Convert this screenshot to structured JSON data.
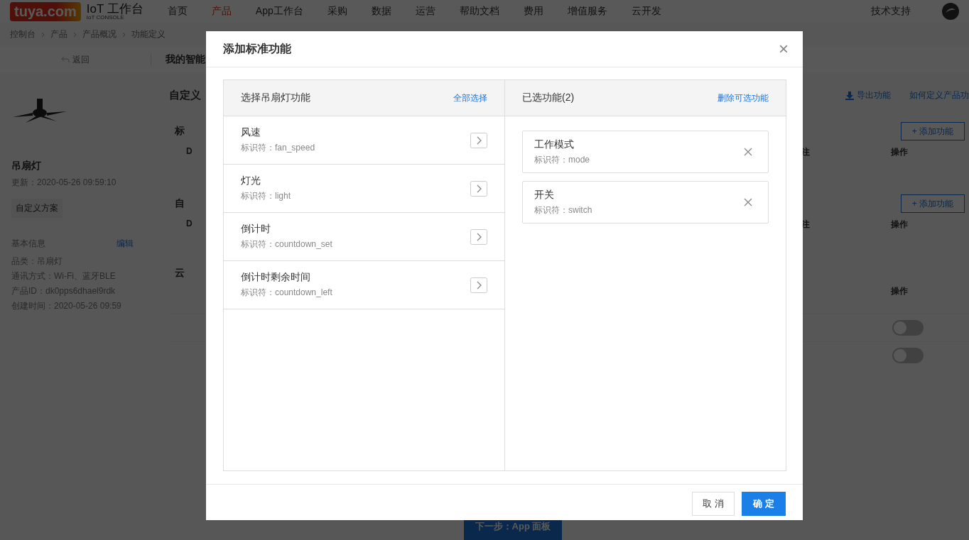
{
  "header": {
    "logo": "tuya.com",
    "console_title": "IoT 工作台",
    "console_subtitle": "IoT CONSOLE",
    "nav": [
      {
        "label": "首页",
        "selected": false
      },
      {
        "label": "产品",
        "selected": true
      },
      {
        "label": "App工作台",
        "selected": false
      },
      {
        "label": "采购",
        "selected": false
      },
      {
        "label": "数据",
        "selected": false
      },
      {
        "label": "运营",
        "selected": false
      },
      {
        "label": "帮助文档",
        "selected": false
      },
      {
        "label": "费用",
        "selected": false
      },
      {
        "label": "增值服务",
        "selected": false
      },
      {
        "label": "云开发",
        "selected": false
      }
    ],
    "support": "技术支持"
  },
  "breadcrumb": [
    "控制台",
    "产品",
    "产品概况",
    "功能定义"
  ],
  "back": "返回",
  "page_title": "我的智能",
  "product": {
    "name": "吊扇灯",
    "updated": "更新：2020-05-26 09:59:10",
    "scheme": "自定义方案",
    "info_title": "基本信息",
    "edit": "编辑",
    "info": [
      "品类：吊扇灯",
      "通讯方式：Wi-Fi、蓝牙BLE",
      "产品ID：dk0pps6dhael9rdk",
      "创建时间：2020-05-26 09:59"
    ]
  },
  "main": {
    "title": "自定义",
    "export": "导出功能",
    "howto": "如何定义产品功",
    "sections": [
      {
        "title": "标",
        "col_1": "D",
        "col_remark": "注",
        "col_action": "操作",
        "add": "+ 添加功能"
      },
      {
        "title": "自",
        "col_1": "D",
        "col_remark": "注",
        "col_action": "操作",
        "add": "+ 添加功能"
      },
      {
        "title": "云",
        "col_action": "操作",
        "toggles": [
          {
            "on": false
          },
          {
            "on": false
          }
        ]
      }
    ]
  },
  "next_button": "下一步：App 面板",
  "dialog": {
    "title": "添加标准功能",
    "close": "×",
    "left": {
      "title": "选择吊扇灯功能",
      "action": "全部选择",
      "items": [
        {
          "name": "风速",
          "id": "标识符：fan_speed"
        },
        {
          "name": "灯光",
          "id": "标识符：light"
        },
        {
          "name": "倒计时",
          "id": "标识符：countdown_set"
        },
        {
          "name": "倒计时剩余时间",
          "id": "标识符：countdown_left"
        }
      ]
    },
    "right": {
      "title": "已选功能(2)",
      "action": "删除可选功能",
      "items": [
        {
          "name": "工作模式",
          "id": "标识符：mode"
        },
        {
          "name": "开关",
          "id": "标识符：switch"
        }
      ]
    },
    "cancel": "取 消",
    "ok": "确 定"
  }
}
